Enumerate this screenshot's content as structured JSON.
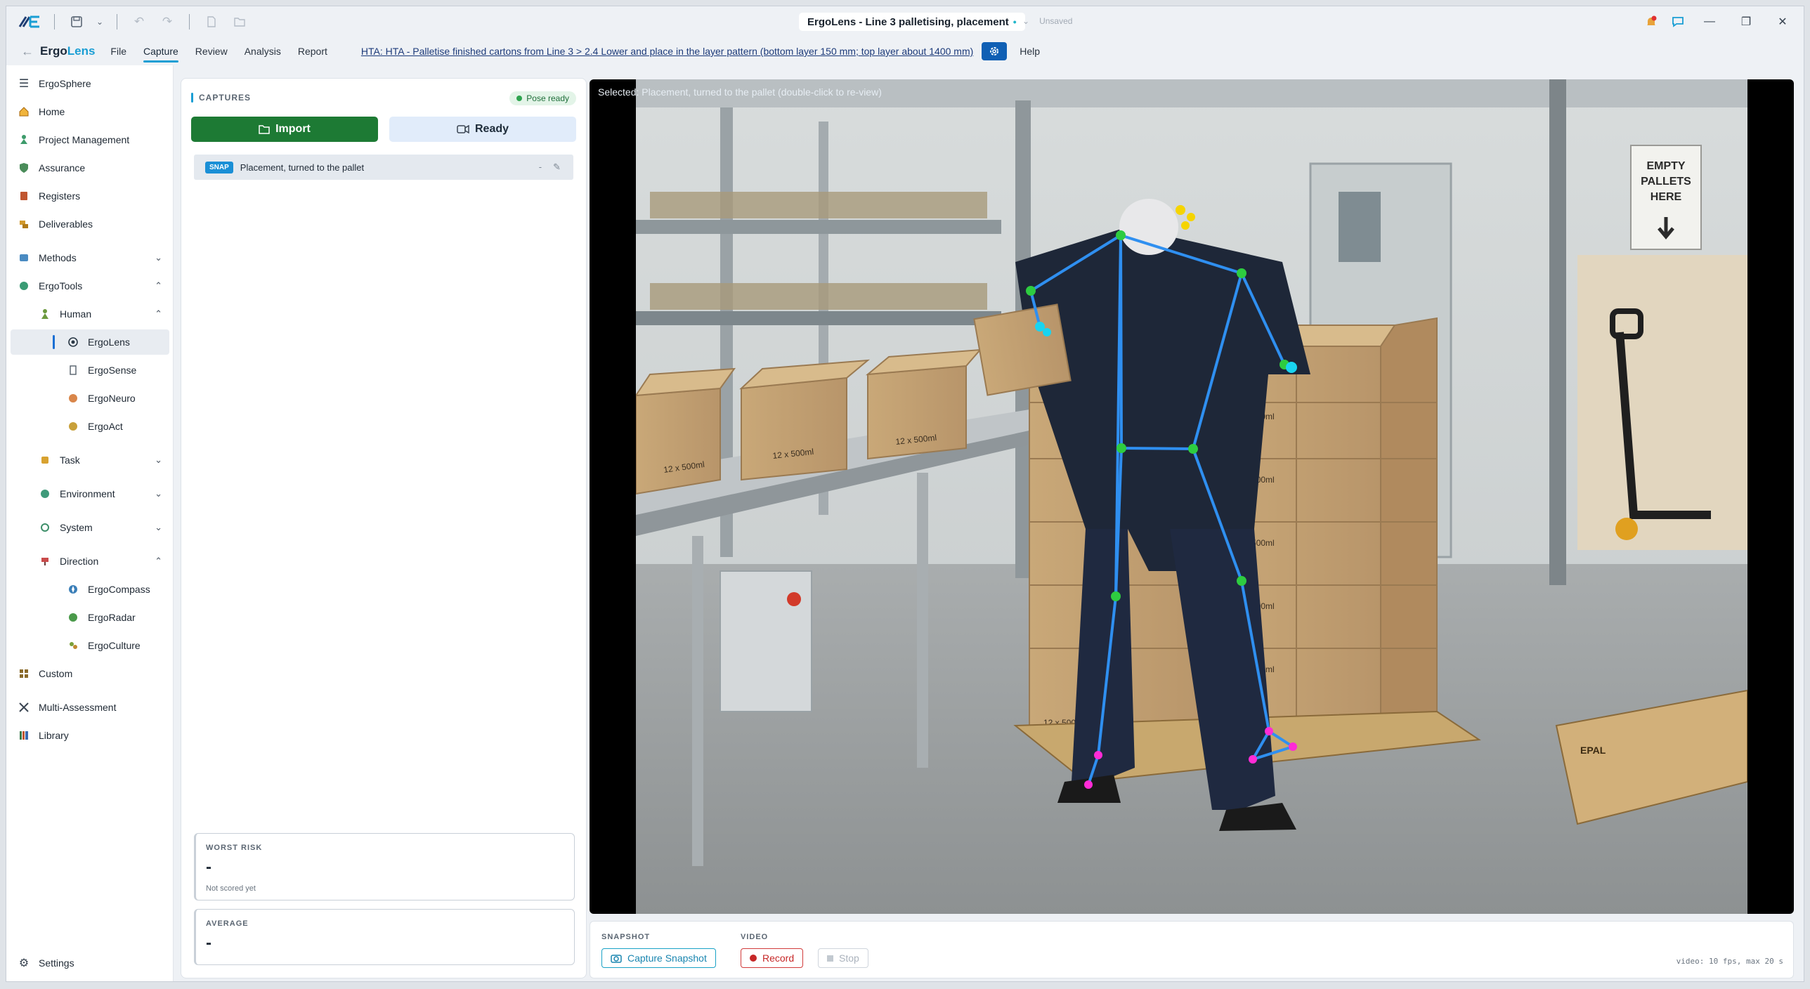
{
  "window": {
    "title": "ErgoLens - Line 3 palletising, placement",
    "modified_marker": "•",
    "save_state": "Unsaved",
    "chevron": "⌄"
  },
  "menubar": {
    "brand_part1": "Ergo",
    "brand_part2": "Lens",
    "items": [
      "File",
      "Capture",
      "Review",
      "Analysis",
      "Report"
    ],
    "active_item": "Capture",
    "hta_link": "HTA: HTA - Palletise finished cartons from Line 3 > 2.4 Lower and place in the layer pattern (bottom layer 150 mm; top layer about 1400 mm)",
    "help": "Help"
  },
  "sidebar": {
    "header": "ErgoSphere",
    "items": [
      {
        "label": "Home",
        "icon": "home-icon"
      },
      {
        "label": "Project Management",
        "icon": "project-icon"
      },
      {
        "label": "Assurance",
        "icon": "shield-icon"
      },
      {
        "label": "Registers",
        "icon": "register-icon"
      },
      {
        "label": "Deliverables",
        "icon": "deliverables-icon"
      },
      {
        "label": "Methods",
        "icon": "methods-icon",
        "chevron": "⌄"
      },
      {
        "label": "ErgoTools",
        "icon": "tools-icon",
        "chevron": "⌃"
      },
      {
        "label": "Human",
        "icon": "human-icon",
        "chevron": "⌃"
      },
      {
        "label": "ErgoLens",
        "icon": "lens-icon"
      },
      {
        "label": "ErgoSense",
        "icon": "sense-icon"
      },
      {
        "label": "ErgoNeuro",
        "icon": "neuro-icon"
      },
      {
        "label": "ErgoAct",
        "icon": "act-icon"
      },
      {
        "label": "Task",
        "icon": "task-icon",
        "chevron": "⌄"
      },
      {
        "label": "Environment",
        "icon": "environment-icon",
        "chevron": "⌄"
      },
      {
        "label": "System",
        "icon": "system-icon",
        "chevron": "⌄"
      },
      {
        "label": "Direction",
        "icon": "direction-icon",
        "chevron": "⌃"
      },
      {
        "label": "ErgoCompass",
        "icon": "compass-icon"
      },
      {
        "label": "ErgoRadar",
        "icon": "radar-icon"
      },
      {
        "label": "ErgoCulture",
        "icon": "culture-icon"
      },
      {
        "label": "Custom",
        "icon": "custom-icon"
      },
      {
        "label": "Multi-Assessment",
        "icon": "multi-icon"
      },
      {
        "label": "Library",
        "icon": "library-icon"
      }
    ],
    "settings": "Settings"
  },
  "captures": {
    "heading": "CAPTURES",
    "status_badge": "Pose ready",
    "import_label": "Import",
    "ready_label": "Ready",
    "list": [
      {
        "tag": "SNAP",
        "label": "Placement, turned to the pallet",
        "action_more": "-",
        "action_edit": "✎"
      }
    ],
    "worst_risk": {
      "label": "WORST RISK",
      "value": "-",
      "note": "Not scored yet"
    },
    "average": {
      "label": "AVERAGE",
      "value": "-"
    }
  },
  "viewer": {
    "selected_text": "Selected: Placement, turned to the pallet (double-click to re-view)",
    "sign_text": [
      "EMPTY",
      "PALLETS",
      "HERE"
    ],
    "carton_label": "12 x 500ml",
    "pallet_brand": "EPAL",
    "colors": {
      "skeleton": "#2f8ff0",
      "joint": "#2ecc40",
      "head": "#f5d400",
      "hand": "#19d4f0",
      "foot": "#ff2bd6"
    }
  },
  "bottombar": {
    "snapshot_label": "SNAPSHOT",
    "video_label": "VIDEO",
    "capture_btn": "Capture Snapshot",
    "record_btn": "Record",
    "stop_btn": "Stop",
    "fps_note": "video: 10 fps, max 20 s"
  }
}
